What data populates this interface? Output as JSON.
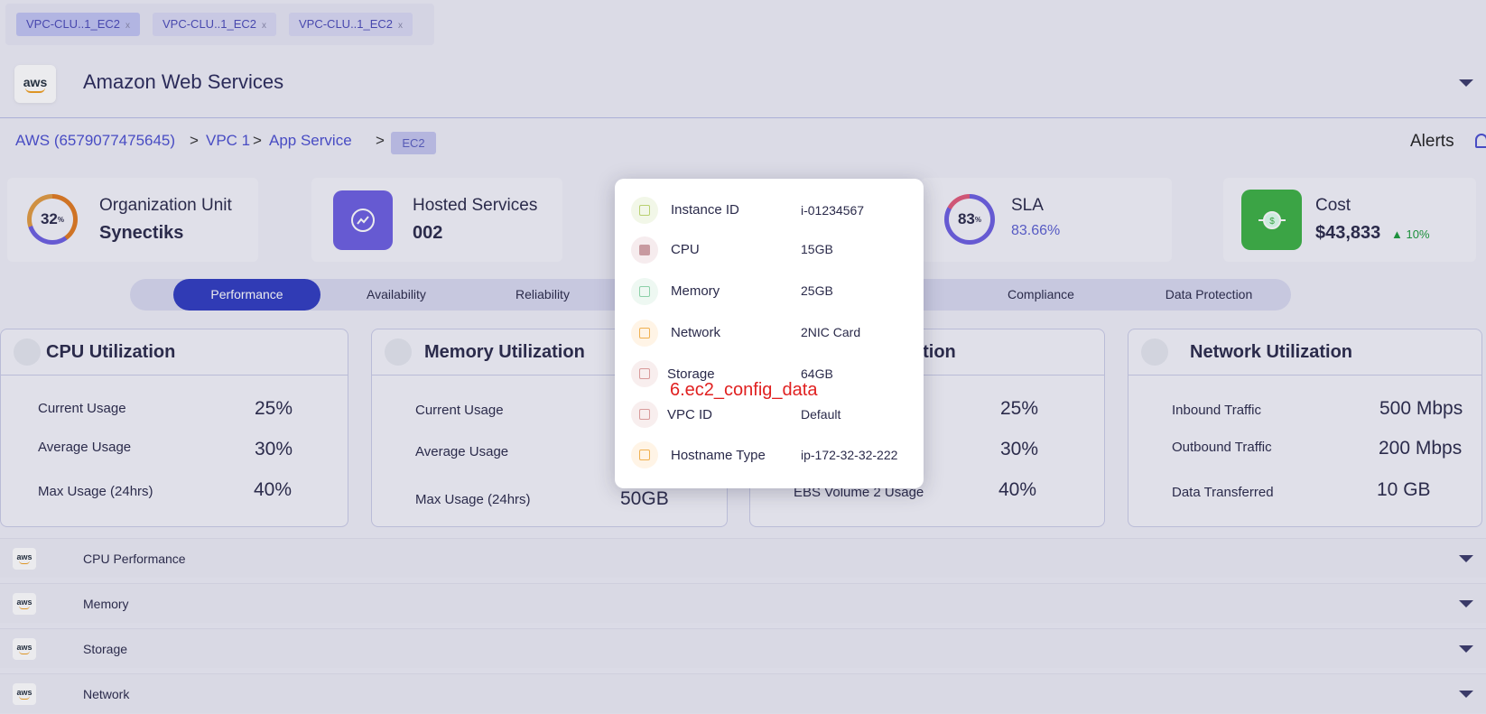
{
  "tabs": [
    {
      "label": "VPC-CLU..1_EC2",
      "close": "x"
    },
    {
      "label": "VPC-CLU..1_EC2",
      "close": "x"
    },
    {
      "label": "VPC-CLU..1_EC2",
      "close": "x"
    }
  ],
  "header": {
    "logo_text": "aws",
    "title": "Amazon Web Services"
  },
  "breadcrumb": {
    "items": [
      "AWS (6579077475645)",
      "VPC 1",
      "App Service"
    ],
    "separator": ">",
    "current": "EC2"
  },
  "alerts_label": "Alerts",
  "stats": {
    "org": {
      "percent": "32",
      "unit": "%",
      "label": "Organization Unit",
      "value": "Synectiks"
    },
    "hosted": {
      "label": "Hosted Services",
      "value": "002"
    },
    "sla": {
      "percent": "83",
      "unit": "%",
      "label": "SLA",
      "value": "83.66%"
    },
    "cost": {
      "label": "Cost",
      "value": "$43,833",
      "trend": "10%",
      "trend_color": "#1a9a3a"
    }
  },
  "segments": [
    "Performance",
    "Availability",
    "Reliability",
    "Compliance",
    "Data Protection"
  ],
  "cpu": {
    "title": "CPU Utilization",
    "rows": [
      {
        "label": "Current Usage",
        "value": "25%"
      },
      {
        "label": "Average Usage",
        "value": "30%"
      },
      {
        "label": "Max Usage (24hrs)",
        "value": "40%"
      }
    ]
  },
  "memory": {
    "title": "Memory Utilization",
    "rows": [
      {
        "label": "Current Usage"
      },
      {
        "label": "Average Usage"
      },
      {
        "label": "Max Usage (24hrs)",
        "value": "50GB"
      }
    ]
  },
  "storage": {
    "title_fragment": "ation",
    "rows": [
      {
        "value": "25%"
      },
      {
        "value": "30%"
      },
      {
        "label": "EBS Volume 2 Usage",
        "value": "40%"
      }
    ]
  },
  "network": {
    "title": "Network Utilization",
    "rows": [
      {
        "label": "Inbound Traffic",
        "value": "500 Mbps"
      },
      {
        "label": "Outbound Traffic",
        "value": "200 Mbps"
      },
      {
        "label": "Data Transferred",
        "value": "10 GB"
      }
    ]
  },
  "accordion": [
    {
      "logo": "aws",
      "label": "CPU Performance"
    },
    {
      "logo": "aws",
      "label": "Memory"
    },
    {
      "logo": "aws",
      "label": "Storage"
    },
    {
      "logo": "aws",
      "label": "Network"
    }
  ],
  "popup": {
    "rows": [
      {
        "label": "Instance ID",
        "value": "i-01234567",
        "icon": "chip-icon"
      },
      {
        "label": "CPU",
        "value": "15GB",
        "icon": "cpu-icon"
      },
      {
        "label": "Memory",
        "value": "25GB",
        "icon": "memory-icon"
      },
      {
        "label": "Network",
        "value": "2NIC Card",
        "icon": "network-icon"
      },
      {
        "label": "Storage",
        "value": "64GB",
        "icon": "storage-icon"
      },
      {
        "label": "VPC ID",
        "value": "Default",
        "icon": "vpc-icon"
      },
      {
        "label": "Hostname Type",
        "value": "ip-172-32-32-222",
        "icon": "hostname-icon"
      }
    ]
  },
  "annotation": "6.ec2_config_data",
  "colors": {
    "accent": "#2f3bc0",
    "link": "#4a4ed0",
    "hosted": "#6b5ee0",
    "cost": "#3cb043",
    "annotation": "#e02020"
  }
}
